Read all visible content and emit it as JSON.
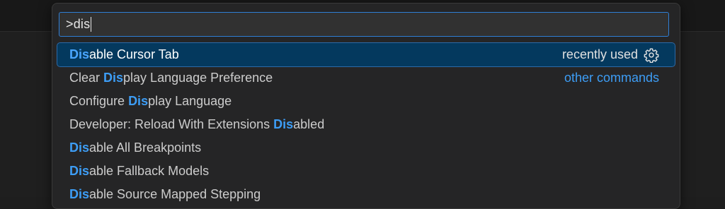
{
  "command_palette": {
    "input": {
      "value": ">dis"
    },
    "items": [
      {
        "prefix": "",
        "match": "Dis",
        "suffix": "able Cursor Tab",
        "right": "recently used",
        "right_type": "recent",
        "selected": true
      },
      {
        "prefix": "Clear ",
        "match": "Dis",
        "suffix": "play Language Preference",
        "right": "other commands",
        "right_type": "group"
      },
      {
        "prefix": "Configure ",
        "match": "Dis",
        "suffix": "play Language",
        "right": "",
        "right_type": ""
      },
      {
        "prefix": "Developer: Reload With Extensions ",
        "match": "Dis",
        "suffix": "abled",
        "right": "",
        "right_type": ""
      },
      {
        "prefix": "",
        "match": "Dis",
        "suffix": "able All Breakpoints",
        "right": "",
        "right_type": ""
      },
      {
        "prefix": "",
        "match": "Dis",
        "suffix": "able Fallback Models",
        "right": "",
        "right_type": ""
      },
      {
        "prefix": "",
        "match": "Dis",
        "suffix": "able Source Mapped Stepping",
        "right": "",
        "right_type": ""
      }
    ],
    "icons": {
      "configure": "gear-icon"
    },
    "colors": {
      "accent": "#3d9df5",
      "selection": "#04395e",
      "focus_border": "#2f7fd6"
    }
  }
}
